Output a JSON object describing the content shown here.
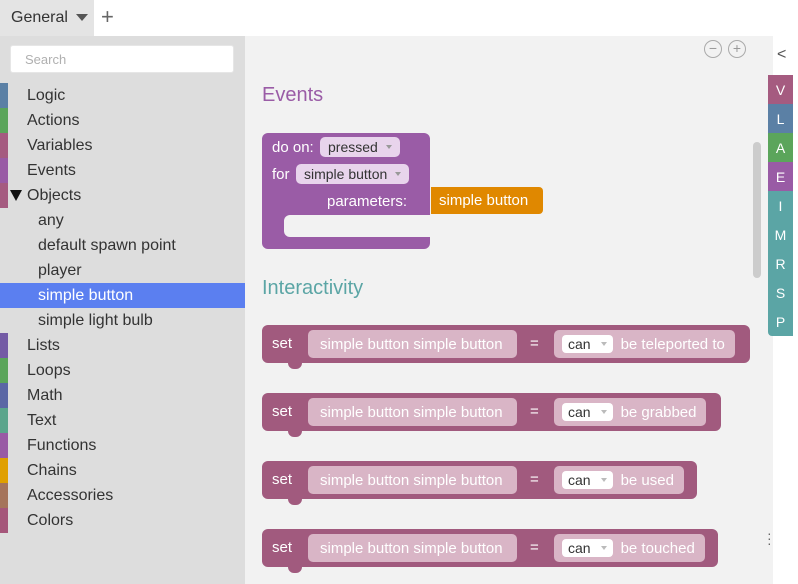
{
  "tabs": {
    "active": "General",
    "add_icon": "+"
  },
  "search": {
    "placeholder": "Search"
  },
  "categories": [
    {
      "label": "Logic",
      "color": "#5b80a5"
    },
    {
      "label": "Actions",
      "color": "#5ba55b"
    },
    {
      "label": "Variables",
      "color": "#a55b80"
    },
    {
      "label": "Events",
      "color": "#995ba5"
    },
    {
      "label": "Objects",
      "color": "#a55b80",
      "expanded": true
    },
    {
      "label": "any",
      "sub": true
    },
    {
      "label": "default spawn point",
      "sub": true
    },
    {
      "label": "player",
      "sub": true
    },
    {
      "label": "simple button",
      "sub": true,
      "selected": true
    },
    {
      "label": "simple light bulb",
      "sub": true
    },
    {
      "label": "Lists",
      "color": "#745ba5"
    },
    {
      "label": "Loops",
      "color": "#5ba55b"
    },
    {
      "label": "Math",
      "color": "#5b67a5"
    },
    {
      "label": "Text",
      "color": "#5ba58c"
    },
    {
      "label": "Functions",
      "color": "#995ba5"
    },
    {
      "label": "Chains",
      "color": "#e0a000"
    },
    {
      "label": "Accessories",
      "color": "#a5745b"
    },
    {
      "label": "Colors",
      "color": "#a5567a"
    }
  ],
  "workspace": {
    "events_title": "Events",
    "interactivity_title": "Interactivity",
    "events_color": "#9a5ca6",
    "interactivity_color": "#5ba5a5",
    "event_block": {
      "do_on": "do on:",
      "do_on_value": "pressed",
      "for": "for",
      "for_value": "simple button",
      "parameters": "parameters:",
      "param_value": "simple button"
    },
    "set_blocks": [
      {
        "set": "set",
        "var": "simple button simple button",
        "eq": "=",
        "can": "can",
        "suffix": "be teleported to"
      },
      {
        "set": "set",
        "var": "simple button simple button",
        "eq": "=",
        "can": "can",
        "suffix": "be grabbed"
      },
      {
        "set": "set",
        "var": "simple button simple button",
        "eq": "=",
        "can": "can",
        "suffix": "be used"
      },
      {
        "set": "set",
        "var": "simple button simple button",
        "eq": "=",
        "can": "can",
        "suffix": "be touched"
      }
    ]
  },
  "rightpanel": {
    "collapse_icon": "<",
    "letters": [
      {
        "label": "V",
        "color": "#a55b80"
      },
      {
        "label": "L",
        "color": "#5b80a5"
      },
      {
        "label": "A",
        "color": "#5ba55b"
      },
      {
        "label": "E",
        "color": "#995ba5"
      },
      {
        "label": "I",
        "color": "#5ba5a5"
      },
      {
        "label": "M",
        "color": "#5ba5a5"
      },
      {
        "label": "R",
        "color": "#5ba5a5"
      },
      {
        "label": "S",
        "color": "#5ba5a5"
      },
      {
        "label": "P",
        "color": "#5ba5a5"
      }
    ]
  }
}
